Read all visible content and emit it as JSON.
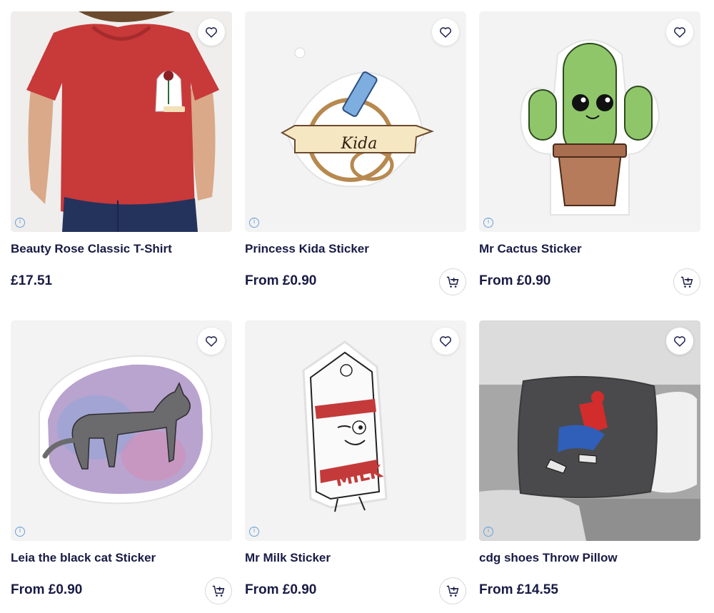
{
  "products": [
    {
      "title": "Beauty Rose Classic T-Shirt",
      "price": "£17.51",
      "has_cart": false,
      "favorite_icon": "heart-outline-icon",
      "info_icon": "info-icon",
      "info_glyph": "i"
    },
    {
      "title": "Princess Kida Sticker",
      "price": "From £0.90",
      "has_cart": true,
      "art_text": "Kida",
      "info_glyph": "i"
    },
    {
      "title": "Mr Cactus Sticker",
      "price": "From £0.90",
      "has_cart": true,
      "info_glyph": "i"
    },
    {
      "title": "Leia the black cat Sticker",
      "price": "From £0.90",
      "has_cart": true,
      "info_glyph": "i"
    },
    {
      "title": "Mr Milk Sticker",
      "price": "From £0.90",
      "has_cart": true,
      "art_text": "MILK",
      "info_glyph": "i"
    },
    {
      "title": "cdg shoes Throw Pillow",
      "price": "From £14.55",
      "has_cart": false,
      "info_glyph": "i"
    }
  ],
  "colors": {
    "text": "#191b45",
    "info": "#6a9fd8",
    "thumb_bg": "#f3f3f3"
  }
}
